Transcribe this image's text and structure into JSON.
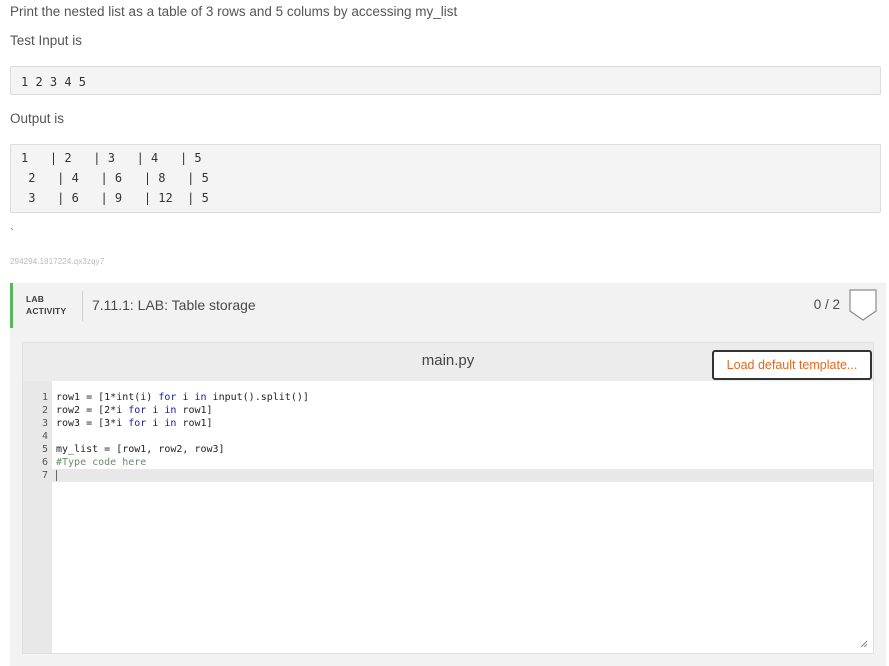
{
  "prompt": {
    "intro": "Print the nested list as a table of 3 rows and 5 colums by accessing my_list",
    "test_input_label": "Test Input is",
    "test_input_value": "1 2 3 4 5",
    "output_label": "Output is",
    "output_lines": [
      "1   | 2   | 3   | 4   | 5",
      " 2   | 4   | 6   | 8   | 5",
      " 3   | 6   | 9   | 12  | 5"
    ],
    "stray_char": "`",
    "tracking_id": "294294.1817224.qx3zqy7"
  },
  "lab": {
    "tag_line1": "LAB",
    "tag_line2": "ACTIVITY",
    "title": "7.11.1: LAB: Table storage",
    "score": "0 / 2"
  },
  "editor": {
    "file_name": "main.py",
    "load_button_label": "Load default template...",
    "line_numbers": [
      "1",
      "2",
      "3",
      "4",
      "5",
      "6",
      "7"
    ],
    "code_lines": [
      "row1 = [1*int(i) for i in input().split()]",
      "row2 = [2*i for i in row1]",
      "row3 = [3*i for i in row1]",
      "",
      "my_list = [row1, row2, row3]",
      "#Type code here",
      ""
    ]
  },
  "colors": {
    "accent_green": "#5bb75b",
    "button_text_orange": "#e8691d",
    "keyword_blue": "#1a1aa6"
  }
}
